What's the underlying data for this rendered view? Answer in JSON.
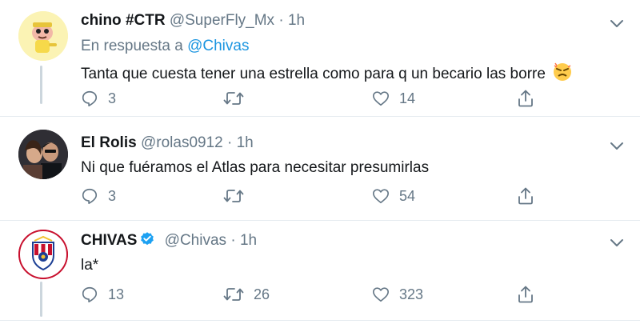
{
  "colors": {
    "link": "#1b95e0",
    "muted": "#657786",
    "text": "#14171a",
    "divider": "#e6ecf0",
    "thread": "#ccd6dd"
  },
  "tweets": [
    {
      "name": "chino #CTR",
      "handle": "@SuperFly_Mx",
      "dot": "·",
      "time": "1h",
      "reply_prefix": "En respuesta a",
      "reply_to": "@Chivas",
      "text": "Tanta que cuesta tener una estrella como para q un becario las borre",
      "emoji": "angry-face-emoji",
      "replies": "3",
      "retweets": "",
      "likes": "14"
    },
    {
      "name": "El Rolis",
      "handle": "@rolas0912",
      "dot": "·",
      "time": "1h",
      "text": "Ni que fuéramos el Atlas para necesitar presumirlas",
      "replies": "3",
      "retweets": "",
      "likes": "54"
    },
    {
      "name": "CHIVAS",
      "handle": "@Chivas",
      "dot": "·",
      "time": "1h",
      "text": "la*",
      "replies": "13",
      "retweets": "26",
      "likes": "323"
    }
  ]
}
